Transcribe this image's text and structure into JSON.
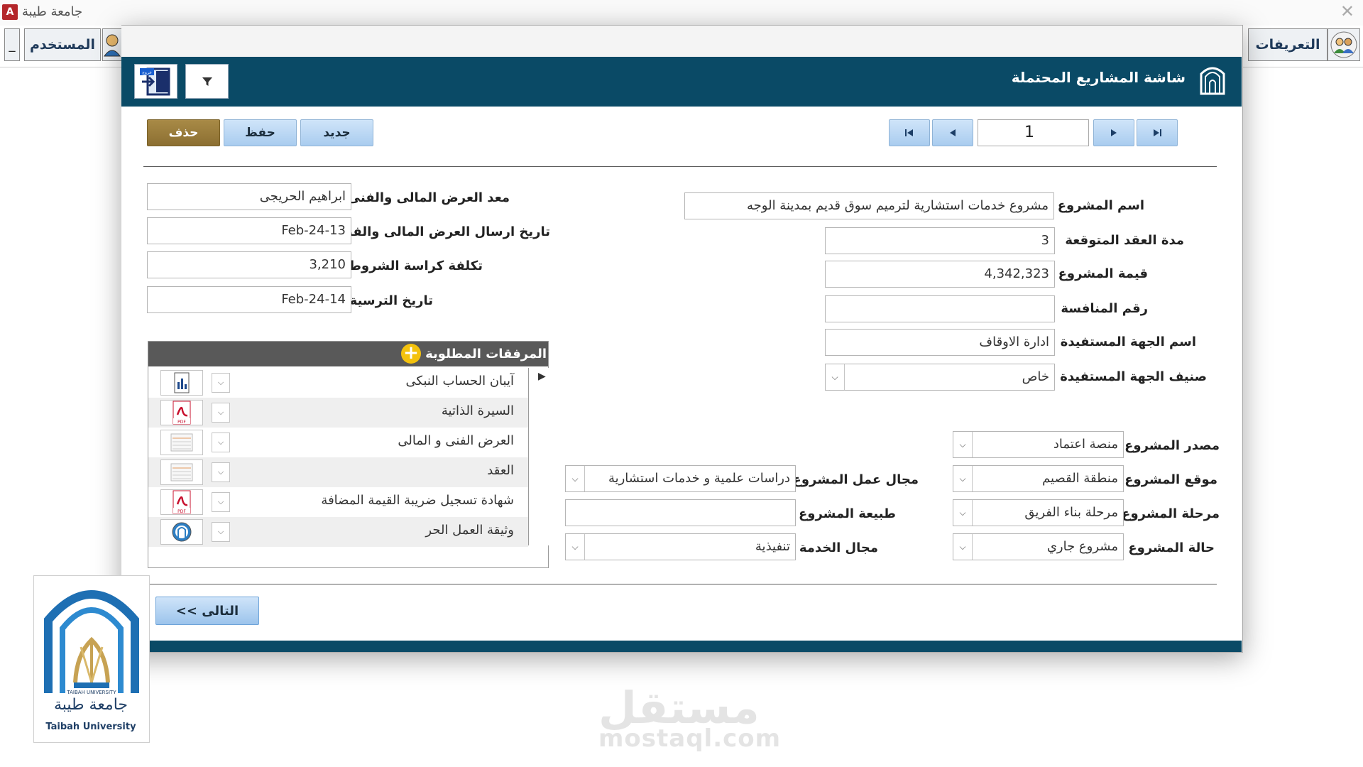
{
  "app": {
    "title": "جامعة طيبة",
    "icon_letter": "A"
  },
  "ribbon": {
    "definitions_label": "التعريفات",
    "user_label": "المستخدم",
    "minimize_label": "_"
  },
  "window": {
    "title": "شاشة المشاريع المحتملة"
  },
  "toolbar": {
    "delete_label": "حذف",
    "save_label": "حفظ",
    "new_label": "جديد",
    "exit_label": "خروج"
  },
  "navigation": {
    "record": "1"
  },
  "fields": {
    "project_name": {
      "label": "اسم المشروع",
      "value": "مشروع خدمات استشارية لترميم سوق قديم بمدينة الوجه"
    },
    "contract_duration": {
      "label": "مدة العقد المتوقعة",
      "value": "3"
    },
    "project_value": {
      "label": "قيمة المشروع",
      "value": "4,342,323"
    },
    "tender_number": {
      "label": "رقم المنافسة",
      "value": ""
    },
    "beneficiary_name": {
      "label": "اسم الجهة المستفيدة",
      "value": "ادارة الاوقاف"
    },
    "beneficiary_class": {
      "label": "صنيف الجهة المستفيدة",
      "value": "خاص"
    },
    "offer_preparer": {
      "label": "معد العرض المالى والفنى",
      "value": "ابراهيم الحريجى"
    },
    "offer_send_date": {
      "label": "تاريخ ارسال العرض المالى والفنى",
      "value": "13-Feb-24"
    },
    "terms_cost": {
      "label": "تكلفة كراسة الشروط",
      "value": "3,210"
    },
    "award_date": {
      "label": "تاريخ الترسية",
      "value": "14-Feb-24"
    },
    "project_source": {
      "label": "مصدر المشروع",
      "value": "منصة اعتماد"
    },
    "project_location": {
      "label": "موقع المشروع",
      "value": "منطقة القصيم"
    },
    "project_stage": {
      "label": "مرحلة المشروع",
      "value": "مرحلة بناء الفريق"
    },
    "project_status": {
      "label": "حالة المشروع",
      "value": "مشروع جاري"
    },
    "work_field": {
      "label": "مجال عمل المشروع",
      "value": "دراسات علمية و خدمات استشارية"
    },
    "project_nature": {
      "label": "طبيعة المشروع",
      "value": ""
    },
    "service_field": {
      "label": "مجال الخدمة",
      "value": "تنفيذية"
    }
  },
  "attachments": {
    "title": "المرفقات المطلوبة",
    "items": [
      {
        "name": "آيبان الحساب النبكى",
        "icon": "document-chart-icon"
      },
      {
        "name": "السيرة الذاتية",
        "icon": "pdf-icon"
      },
      {
        "name": "العرض الفنى و المالى",
        "icon": "spreadsheet-icon"
      },
      {
        "name": "العقد",
        "icon": "spreadsheet-icon"
      },
      {
        "name": "شهادة تسجيل ضريبة القيمة المضافة",
        "icon": "pdf-icon"
      },
      {
        "name": "وثيقة العمل الحر",
        "icon": "badge-icon"
      }
    ]
  },
  "footer": {
    "next_label": "<< التالى"
  },
  "logo": {
    "ar": "جامعة طيبة",
    "en": "Taibah University",
    "tiny": "TAIBAH UNIVERSITY"
  },
  "watermark": {
    "ar": "مستقل",
    "en": "mostaql.com"
  },
  "colors": {
    "header": "#0a4a66",
    "delete": "#8c6f32",
    "button": "#b9d7f3",
    "attach_header": "#595959",
    "add": "#f4c20d"
  }
}
